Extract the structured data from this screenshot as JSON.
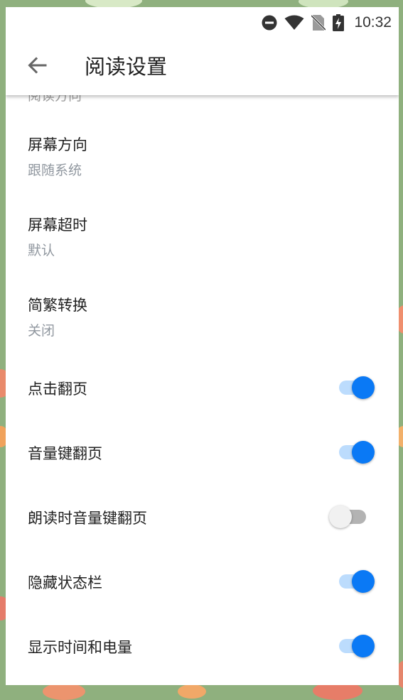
{
  "status_bar": {
    "time": "10:32",
    "icons": [
      "do-not-disturb-icon",
      "wifi-icon",
      "no-sim-icon",
      "battery-charging-icon"
    ]
  },
  "app_bar": {
    "back_icon": "arrow-back-icon",
    "title": "阅读设置"
  },
  "preferences": {
    "peek_item": "阅读方向",
    "items": [
      {
        "title": "屏幕方向",
        "summary": "跟随系统"
      },
      {
        "title": "屏幕超时",
        "summary": "默认"
      },
      {
        "title": "简繁转换",
        "summary": "关闭"
      }
    ],
    "switches": [
      {
        "title": "点击翻页",
        "checked": true
      },
      {
        "title": "音量键翻页",
        "checked": true
      },
      {
        "title": "朗读时音量键翻页",
        "checked": false
      },
      {
        "title": "隐藏状态栏",
        "checked": true
      },
      {
        "title": "显示时间和电量",
        "checked": true
      }
    ]
  },
  "colors": {
    "accent": "#0a79f5",
    "accent_track": "#bcdcfd",
    "summary_text": "#90979f",
    "border_background": "#8fb07e"
  }
}
